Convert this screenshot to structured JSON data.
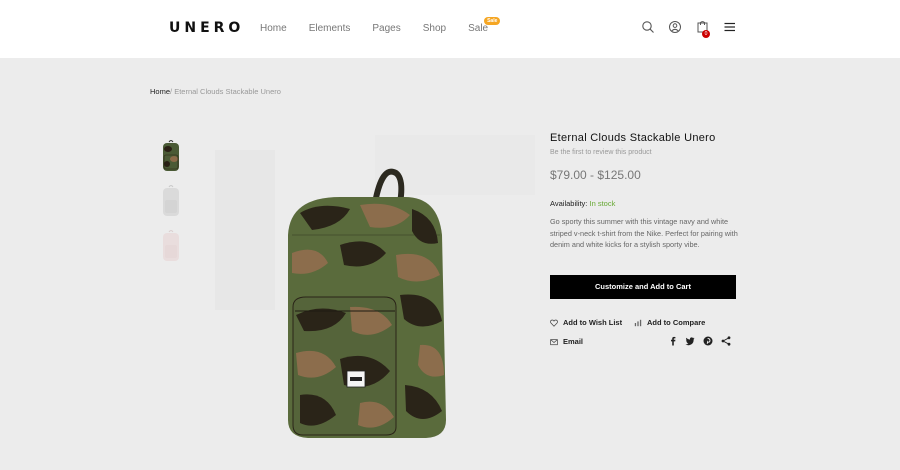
{
  "header": {
    "logo": "UNERO",
    "nav": [
      {
        "label": "Home"
      },
      {
        "label": "Elements"
      },
      {
        "label": "Pages"
      },
      {
        "label": "Shop"
      },
      {
        "label": "Sale",
        "badge": "Sale"
      }
    ],
    "cart_count": "0",
    "icons": [
      "search-icon",
      "user-icon",
      "cart-icon",
      "menu-icon"
    ]
  },
  "breadcrumb": {
    "home": "Home",
    "separator": "/",
    "current": "Eternal Clouds Stackable Unero"
  },
  "product": {
    "title": "Eternal Clouds Stackable Unero",
    "review_text": "Be the first to review this product",
    "price": "$79.00 - $125.00",
    "availability_label": "Availability:",
    "availability_value": "In stock",
    "description": "Go sporty this summer with this vintage navy and white striped v-neck t-shirt from the Nike. Perfect for pairing with denim and white kicks for a stylish sporty vibe.",
    "cart_button": "Customize and Add to Cart",
    "wishlist": "Add to Wish List",
    "compare": "Add to Compare",
    "email": "Email",
    "share_icons": [
      "facebook-icon",
      "twitter-icon",
      "pinterest-icon",
      "share-icon"
    ],
    "bag_label": "UNERO"
  },
  "colors": {
    "accent_badge": "#f5a623",
    "in_stock": "#66a832",
    "button": "#000000",
    "cart_count_bg": "#cc0000"
  }
}
